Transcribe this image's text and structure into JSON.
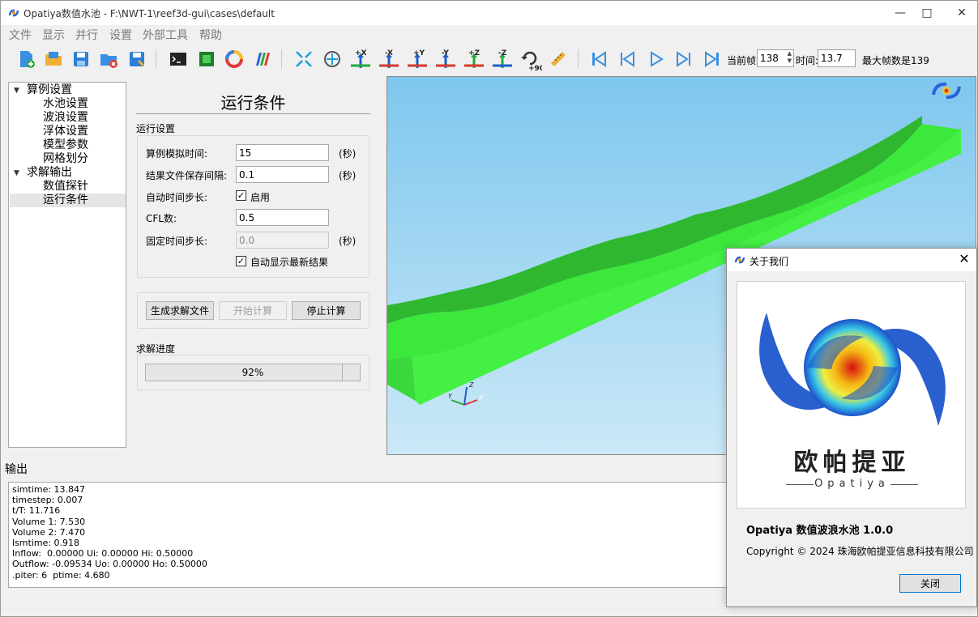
{
  "window": {
    "title": "Opatiya数值水池 - F:\\NWT-1\\reef3d-gui\\cases\\default"
  },
  "menu": [
    "文件",
    "显示",
    "并行",
    "设置",
    "外部工具",
    "帮助"
  ],
  "toolbar": {
    "axis_buttons": [
      "+X",
      "-X",
      "+Y",
      "-Y",
      "+Z",
      "-Z"
    ],
    "rotate_label": "+90",
    "frame_label": "当前帧:",
    "frame_value": "138",
    "time_label": "时间:",
    "time_value": "13.7",
    "max_frame_text": "最大帧数是139"
  },
  "tree": {
    "groups": [
      {
        "label": "算例设置",
        "children": [
          "水池设置",
          "波浪设置",
          "浮体设置",
          "模型参数",
          "网格划分"
        ]
      },
      {
        "label": "求解输出",
        "children": [
          "数值探针",
          "运行条件"
        ]
      }
    ],
    "selected": "运行条件"
  },
  "panel": {
    "title": "运行条件",
    "run_group": "运行设置",
    "sim_time_label": "算例模拟时间:",
    "sim_time_value": "15",
    "save_interval_label": "结果文件保存间隔:",
    "save_interval_value": "0.1",
    "unit_sec": "(秒)",
    "auto_step_label": "自动时间步长:",
    "auto_step_enable": "启用",
    "cfl_label": "CFL数:",
    "cfl_value": "0.5",
    "fixed_step_label": "固定时间步长:",
    "fixed_step_value": "0.0",
    "auto_show_label": "自动显示最新结果",
    "btn_generate": "生成求解文件",
    "btn_start": "开始计算",
    "btn_stop": "停止计算",
    "progress_group": "求解进度",
    "progress_text": "92%",
    "progress_fraction": 0.92
  },
  "output": {
    "label": "输出",
    "lines": [
      "simtime: 13.847",
      "timestep: 0.007",
      "t/T: 11.716",
      "Volume 1: 7.530",
      "Volume 2: 7.470",
      "lsmtime: 0.918",
      "Inflow:  0.00000 Ui: 0.00000 Hi: 0.50000",
      "Outflow: -0.09534 Uo: 0.00000 Ho: 0.50000",
      ".piter: 6  ptime: 4.680"
    ]
  },
  "about": {
    "title": "关于我们",
    "logo_cn": "欧帕提亚",
    "logo_en": "Opatiya",
    "product": "Opatiya 数值波浪水池 1.0.0",
    "copyright": "Copyright © 2024 珠海欧帕提亚信息科技有限公司",
    "close_label": "关闭"
  },
  "view3d": {
    "axes": [
      "X",
      "Y",
      "Z"
    ]
  },
  "colors": {
    "water": "#3ff03f",
    "water_top": "#36d636",
    "sky_top": "#7ec7ee",
    "sky_bottom": "#cbe8f7"
  }
}
